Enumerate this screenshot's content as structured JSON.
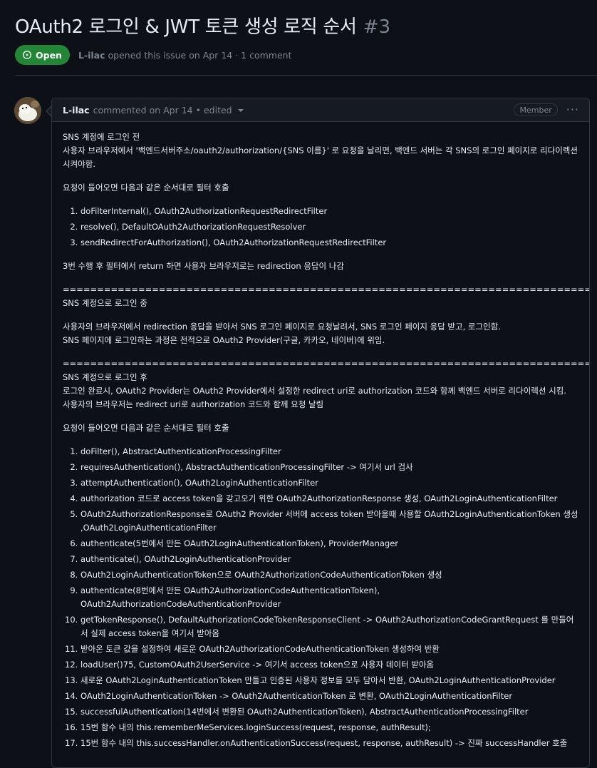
{
  "issue": {
    "title": "OAuth2 로그인 & JWT 토큰 생성 로직 순서",
    "number": "#3",
    "state": "Open",
    "author": "L-ilac",
    "opened_text": "opened this issue on Apr 14 · 1 comment"
  },
  "comment": {
    "author": "L-ilac",
    "meta_text": "commented on Apr 14",
    "edited": "• edited",
    "role": "Member",
    "more": "···",
    "body": {
      "s1_title": "SNS 계정에 로그인 전",
      "s1_line": "사용자 브라우저에서 '백엔드서버주소/oauth2/authorization/{SNS 이름}' 로 요청을 날리면, 백엔드 서버는 각 SNS의 로그인 페이지로 리다이렉션 시켜야함.",
      "s1_intro": "요청이 들어오면 다음과 같은 순서대로 필터 호출",
      "s1_list": [
        "doFilterInternal(), OAuth2AuthorizationRequestRedirectFilter",
        "resolve(), DefaultOAuth2AuthorizationRequestResolver",
        "sendRedirectForAuthorization(), OAuth2AuthorizationRequestRedirectFilter"
      ],
      "s1_after": "3번 수행 후 필터에서 return 하면 사용자 브라우저로는 redirection 응답이 나감",
      "separator": "=================================================================================",
      "s2_title": "SNS 계정으로 로그인 중",
      "s2_line1": "사용자의 브라우저에서 redirection 응답을 받아서 SNS 로그인 페이지로 요청날려서, SNS 로그인 페이지 응답 받고, 로그인함.",
      "s2_line2": "SNS 페이지에 로그인하는 과정은 전적으로 OAuth2 Provider(구글, 카카오, 네이버)에 위임.",
      "s3_title": "SNS 계정으로 로그인 후",
      "s3_line1": "로그인 완료시, OAuth2 Provider는 OAuth2 Provider에서 설정한 redirect uri로 authorization 코드와 함께 백엔드 서버로 리다이렉션 시킴.",
      "s3_line2": "사용자의 브라우저는 redirect uri로 authorization 코드와 함께 요청 날림",
      "s3_intro": "요청이 들어오면 다음과 같은 순서대로 필터 호출",
      "s3_list": [
        "doFilter(), AbstractAuthenticationProcessingFilter",
        "requiresAuthentication(), AbstractAuthenticationProcessingFilter -> 여기서 url 검사",
        "attemptAuthentication(), OAuth2LoginAuthenticationFilter",
        "authorization 코드로 access token을 갖고오기 위한 OAuth2AuthorizationResponse 생성, OAuth2LoginAuthenticationFilter",
        "OAuth2AuthorizationResponse로 OAuth2 Provider 서버에 access token 받아올때 사용할 OAuth2LoginAuthenticationToken 생성 ,OAuth2LoginAuthenticationFilter",
        "authenticate(5번에서 만든 OAuth2LoginAuthenticationToken), ProviderManager",
        "authenticate(), OAuth2LoginAuthenticationProvider",
        "OAuth2LoginAuthenticationToken으로 OAuth2AuthorizationCodeAuthenticationToken 생성",
        "authenticate(8번에서 만든 OAuth2AuthorizationCodeAuthenticationToken), OAuth2AuthorizationCodeAuthenticationProvider",
        "getTokenResponse(), DefaultAuthorizationCodeTokenResponseClient -> OAuth2AuthorizationCodeGrantRequest 를 만들어서 실제 access token을 여기서 받아옴",
        "받아온 토큰 값을 설정하여 새로운 OAuth2AuthorizationCodeAuthenticationToken 생성하여 반환",
        "loadUser()75, CustomOAuth2UserService -> 여기서 access token으로 사용자 데이터 받아옴",
        "새로운 OAuth2LoginAuthenticationToken 만들고 인증된 사용자 정보를 모두 담아서 반환, OAuth2LoginAuthenticationProvider",
        "OAuth2LoginAuthenticationToken -> OAuth2AuthenticationToken 로 변환, OAuth2LoginAuthenticationFilter",
        "successfulAuthentication(14번에서 변환된 OAuth2AuthenticationToken), AbstractAuthenticationProcessingFilter",
        "15번 함수 내의 this.rememberMeServices.loginSuccess(request, response, authResult);",
        "15번 함수 내의 this.successHandler.onAuthenticationSuccess(request, response, authResult) -> 진짜 successHandler 호출"
      ]
    }
  },
  "colors": {
    "background": "#0d1117",
    "open_badge": "#238636",
    "border": "#30363d",
    "muted_text": "#7d8590"
  }
}
